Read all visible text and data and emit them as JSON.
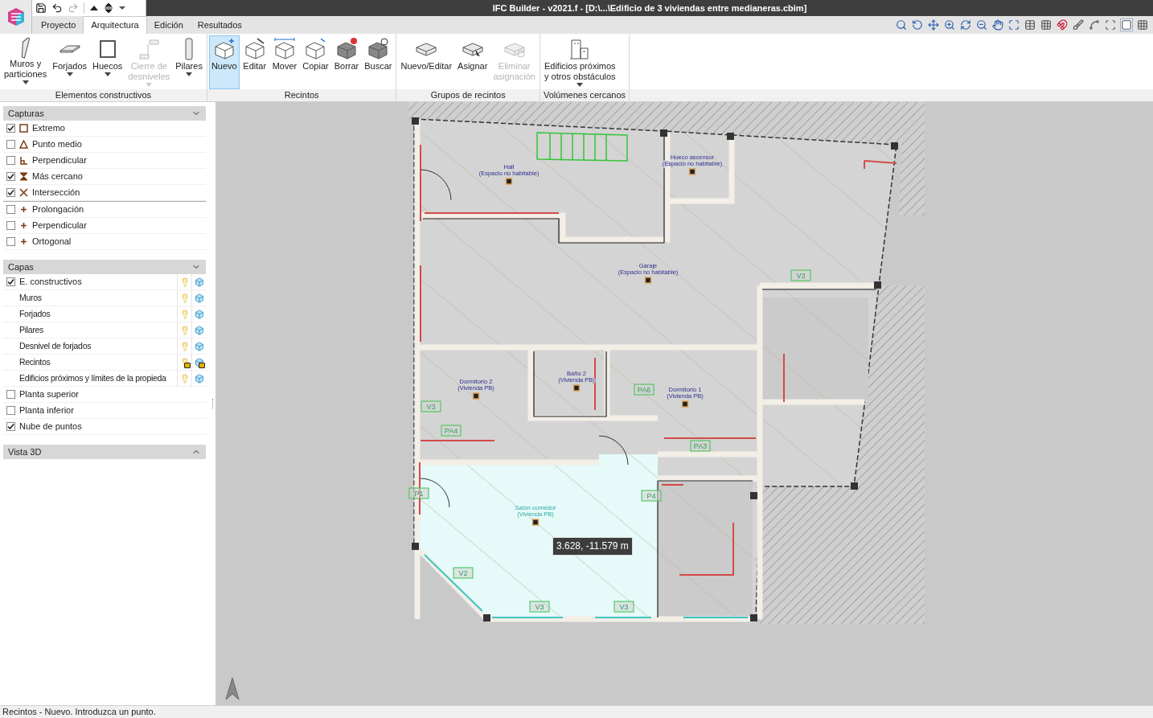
{
  "window": {
    "title": "IFC Builder - v2021.f - [D:\\...\\Edificio de 3 viviendas entre medianeras.cbim]"
  },
  "tabs": [
    {
      "label": "Proyecto",
      "selected": false
    },
    {
      "label": "Arquitectura",
      "selected": true
    },
    {
      "label": "Edición",
      "selected": false
    },
    {
      "label": "Resultados",
      "selected": false
    }
  ],
  "ribbon": {
    "groups": [
      {
        "label": "Elementos constructivos",
        "buttons": [
          {
            "label": "Muros y\nparticiones",
            "disabled": false,
            "selected": false,
            "dropdown": true
          },
          {
            "label": "Forjados",
            "disabled": false,
            "selected": false,
            "dropdown": true
          },
          {
            "label": "Huecos",
            "disabled": false,
            "selected": false,
            "dropdown": true
          },
          {
            "label": "Cierre de\ndesniveles",
            "disabled": true,
            "selected": false,
            "dropdown": true
          },
          {
            "label": "Pilares",
            "disabled": false,
            "selected": false,
            "dropdown": true
          }
        ]
      },
      {
        "label": "Recintos",
        "buttons": [
          {
            "label": "Nuevo",
            "disabled": false,
            "selected": true,
            "dropdown": false
          },
          {
            "label": "Editar",
            "disabled": false,
            "selected": false,
            "dropdown": false
          },
          {
            "label": "Mover",
            "disabled": false,
            "selected": false,
            "dropdown": false
          },
          {
            "label": "Copiar",
            "disabled": false,
            "selected": false,
            "dropdown": false
          },
          {
            "label": "Borrar",
            "disabled": false,
            "selected": false,
            "dropdown": false
          },
          {
            "label": "Buscar",
            "disabled": false,
            "selected": false,
            "dropdown": false
          }
        ]
      },
      {
        "label": "Grupos de recintos",
        "buttons": [
          {
            "label": "Nuevo/Editar",
            "disabled": false,
            "selected": false,
            "dropdown": false
          },
          {
            "label": "Asignar",
            "disabled": false,
            "selected": false,
            "dropdown": false
          },
          {
            "label": "Eliminar\nasignación",
            "disabled": true,
            "selected": false,
            "dropdown": false
          }
        ]
      },
      {
        "label": "Volúmenes cercanos",
        "buttons": [
          {
            "label": "Edificios próximos\ny otros obstáculos",
            "disabled": false,
            "selected": false,
            "dropdown": true
          }
        ]
      }
    ]
  },
  "capturas": {
    "title": "Capturas",
    "expanded": true,
    "items": [
      {
        "label": "Extremo",
        "kind": "square",
        "checked": true
      },
      {
        "label": "Punto medio",
        "kind": "triangle",
        "checked": false
      },
      {
        "label": "Perpendicular",
        "kind": "perpendicular",
        "checked": false
      },
      {
        "label": "Más cercano",
        "kind": "hourglass",
        "checked": true
      },
      {
        "label": "Intersección",
        "kind": "cross",
        "checked": true
      }
    ],
    "tracking": [
      {
        "label": "Prolongación",
        "kind": "plus",
        "checked": false
      },
      {
        "label": "Perpendicular",
        "kind": "plus",
        "checked": false
      },
      {
        "label": "Ortogonal",
        "kind": "plus",
        "checked": false
      }
    ]
  },
  "capas": {
    "title": "Capas",
    "expanded": true,
    "items": [
      {
        "label": "E. constructivos",
        "kind": "layer",
        "checked": true,
        "locked": false
      },
      {
        "label": "Muros",
        "kind": "sublayer",
        "locked": false
      },
      {
        "label": "Forjados",
        "kind": "sublayer",
        "locked": false
      },
      {
        "label": "Pilares",
        "kind": "sublayer",
        "locked": false
      },
      {
        "label": "Desnivel de forjados",
        "kind": "sublayer",
        "locked": false
      },
      {
        "label": "Recintos",
        "kind": "sublayer",
        "locked": true
      },
      {
        "label": "Edificios próximos y límites de la propieda",
        "kind": "sublayer",
        "locked": false
      },
      {
        "label": "Planta superior",
        "kind": "checkbox",
        "checked": false
      },
      {
        "label": "Planta inferior",
        "kind": "checkbox",
        "checked": false
      },
      {
        "label": "Nube de puntos",
        "kind": "checkbox",
        "checked": true
      }
    ]
  },
  "vista3d": {
    "title": "Vista 3D",
    "expanded": false
  },
  "plan": {
    "rooms": [
      {
        "name": "Hall",
        "note": "(Espacio no habitable)",
        "selected": false
      },
      {
        "name": "Hueco ascensor",
        "note": "(Espacio no habitable)",
        "selected": false
      },
      {
        "name": "Garaje",
        "note": "(Espacio no habitable)",
        "selected": false
      },
      {
        "name": "Dormitorio 2",
        "note": "(Vivienda PB)",
        "selected": false
      },
      {
        "name": "Baño 2",
        "note": "(Vivienda PB)",
        "selected": false
      },
      {
        "name": "Dormitorio 1",
        "note": "(Vivienda PB)",
        "selected": false
      },
      {
        "name": "Salón-comedor",
        "note": "(Vivienda PB)",
        "selected": true
      }
    ],
    "tags": [
      "V3",
      "PA4",
      "PA6",
      "PA3",
      "P4",
      "P1",
      "V2",
      "V3",
      "V3",
      "V3"
    ],
    "cursor_readout": "3.628, -11.579 m"
  },
  "status_bar": {
    "text": "Recintos - Nuevo. Introduzca un punto."
  }
}
